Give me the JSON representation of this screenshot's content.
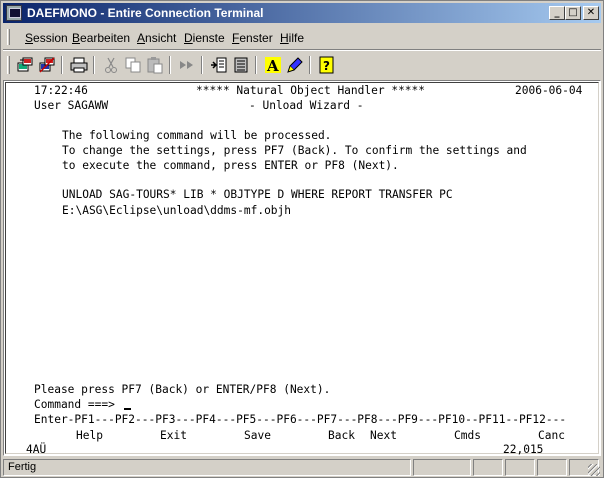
{
  "window": {
    "title": "DAEFMONO - Entire Connection Terminal",
    "controls": {
      "minimize": "_",
      "maximize": "□",
      "close": "✕"
    }
  },
  "menu": [
    {
      "label_u": "S",
      "label_rest": "ession"
    },
    {
      "label_u": "B",
      "label_rest": "earbeiten"
    },
    {
      "label_u": "A",
      "label_rest": "nsicht"
    },
    {
      "label_u": "D",
      "label_rest": "ienste"
    },
    {
      "label_u": "F",
      "label_rest": "enster"
    },
    {
      "label_u": "H",
      "label_rest": "ilfe"
    }
  ],
  "toolbar_icons": [
    "connect-icon",
    "disconnect-icon",
    "print-icon",
    "cut-icon",
    "copy-icon",
    "paste-icon",
    "transfer-icon",
    "receive-icon",
    "send-icon",
    "font-icon",
    "color-icon",
    "help-icon"
  ],
  "terminal": {
    "time": "17:22:46",
    "header_title": "***** Natural Object Handler *****",
    "date": "2006-06-04",
    "user": "User SAGAWW",
    "subtitle": "- Unload Wizard -",
    "msg1": "The following command will be processed.",
    "msg2": "To change the settings, press PF7 (Back). To confirm the settings and",
    "msg3": "to execute the command, press ENTER or PF8 (Next).",
    "cmd1": "UNLOAD SAG-TOURS* LIB * OBJTYPE D WHERE REPORT TRANSFER PC",
    "cmd2": "E:\\ASG\\Eclipse\\unload\\ddms-mf.objh",
    "prompt_msg": "Please press PF7 (Back) or ENTER/PF8 (Next).",
    "command_label": "Command ===>",
    "pf_line": "Enter-PF1---PF2---PF3---PF4---PF5---PF6---PF7---PF8---PF9---PF10--PF11--PF12---",
    "pf_keys": {
      "help": "Help",
      "exit": "Exit",
      "save": "Save",
      "back": "Back",
      "next": "Next",
      "cmds": "Cmds",
      "canc": "Canc"
    },
    "status_left": "4AÜ",
    "status_right": "22,015"
  },
  "statusbar": {
    "text": "Fertig"
  },
  "colors": {
    "titlebar_start": "#0a246a",
    "titlebar_end": "#a6caf0",
    "chrome": "#d4d0c8",
    "terminal_bg": "#ffffff"
  }
}
